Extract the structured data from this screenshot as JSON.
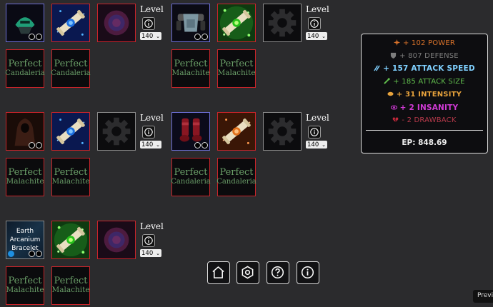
{
  "level_label": "Level",
  "level_value": "140",
  "gem_perfect": "Perfect",
  "gem_candaleria": "Candaleria",
  "gem_malachite": "Malachite",
  "earth_bracelet": [
    "Earth",
    "Arcanium",
    "Bracelet"
  ],
  "stats": [
    {
      "text": "+ 102 POWER",
      "color": "#d9722a",
      "icon": "power-icon"
    },
    {
      "text": "+ 807 DEFENSE",
      "color": "#7d7d7d",
      "icon": "shield-icon"
    },
    {
      "text": "+ 157 ATTACK SPEED",
      "color": "#7fd0ff",
      "icon": "attack-speed-icon"
    },
    {
      "text": "+ 185 ATTACK SIZE",
      "color": "#62c04e",
      "icon": "attack-size-icon"
    },
    {
      "text": "+ 31 INTENSITY",
      "color": "#e8a33c",
      "icon": "intensity-icon"
    },
    {
      "text": "+ 2 INSANITY",
      "color": "#d13ad6",
      "icon": "insanity-icon"
    },
    {
      "text": "- 2 DRAWBACK",
      "color": "#b5394a",
      "icon": "broken-heart-icon"
    }
  ],
  "ep": "EP: 848.69",
  "preview": "Previe"
}
